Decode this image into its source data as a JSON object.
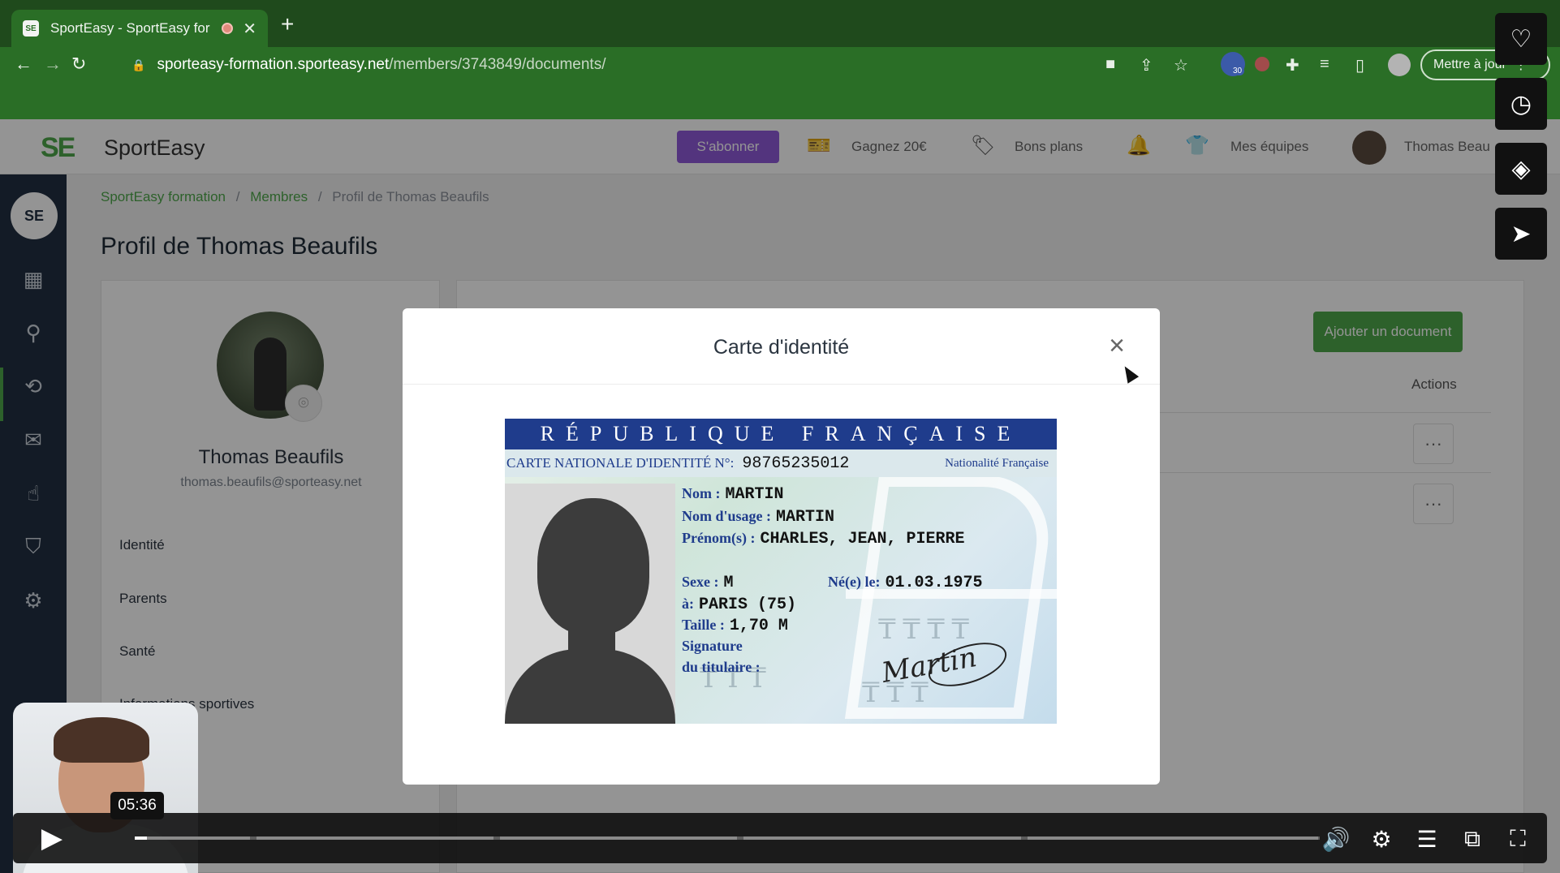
{
  "browser": {
    "tab_title": "SportEasy - SportEasy for",
    "favicon_text": "SE",
    "new_tab": "+",
    "url_host": "sporteasy-formation.sporteasy.net",
    "url_path": "/members/3743849/documents/",
    "extension_badge": "30",
    "update_button": "Mettre à jour",
    "icons": [
      "back-arrow-icon",
      "forward-arrow-icon",
      "reload-icon",
      "lock-icon",
      "camera-icon",
      "share-icon",
      "star-icon",
      "puzzle-icon",
      "queue-icon",
      "sidepanel-icon",
      "menu-dots-icon"
    ]
  },
  "appbar": {
    "logo_mark": "SE",
    "logo_text": "SportEasy",
    "subscribe": "S'abonner",
    "earn": "Gagnez 20€",
    "deals": "Bons plans",
    "teams": "Mes équipes",
    "user": "Thomas Beau"
  },
  "sidebar": {
    "logo": "SE",
    "icons": [
      "calendar-icon",
      "members-icon",
      "exchange-icon",
      "mail-icon",
      "hand-icon",
      "shirt-icon",
      "settings-icon"
    ]
  },
  "breadcrumb": {
    "items": [
      "SportEasy formation",
      "Membres",
      "Profil de Thomas Beaufils"
    ],
    "separator": "/"
  },
  "page_title": "Profil de Thomas Beaufils",
  "profile": {
    "name": "Thomas Beaufils",
    "email": "thomas.beaufils@sporteasy.net",
    "menu": [
      "Identité",
      "Parents",
      "Santé",
      "Informations sportives"
    ]
  },
  "documents": {
    "add_button": "Ajouter un document",
    "actions_header": "Actions",
    "row_action": "···"
  },
  "modal": {
    "title": "Carte d'identité",
    "close": "×"
  },
  "id_card": {
    "header": "RÉPUBLIQUE FRANÇAISE",
    "number_label": "CARTE NATIONALE D'IDENTITÉ N°:",
    "number": "98765235012",
    "nationality": "Nationalité Française",
    "nom_label": "Nom :",
    "nom": "MARTIN",
    "usage_label": "Nom d'usage :",
    "usage": "MARTIN",
    "prenoms_label": "Prénom(s) :",
    "prenoms": "CHARLES, JEAN, PIERRE",
    "sexe_label": "Sexe :",
    "sexe": "M",
    "naissance_label": "Né(e) le:",
    "naissance": "01.03.1975",
    "lieu_label": "à:",
    "lieu": "PARIS (75)",
    "taille_label": "Taille :",
    "taille": "1,70 M",
    "signature_label_1": "Signature",
    "signature_label_2": "du titulaire :",
    "signature": "Martin"
  },
  "player": {
    "time": "05:36",
    "progress_fraction": 0.01,
    "icons": [
      "play-icon",
      "volume-icon",
      "settings-gear-icon",
      "chapters-icon",
      "pip-icon",
      "fullscreen-icon"
    ]
  },
  "side_buttons": [
    "heart-icon",
    "clock-icon",
    "layers-icon",
    "send-icon"
  ]
}
